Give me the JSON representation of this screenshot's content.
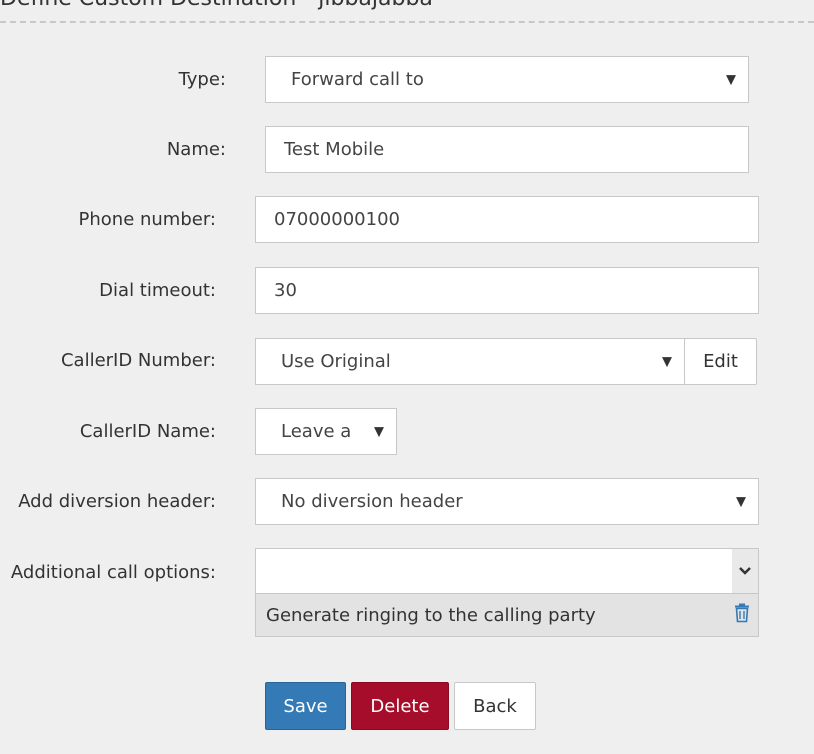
{
  "page": {
    "heading": "Define Custom Destination - jibbajabba"
  },
  "form": {
    "type": {
      "label": "Type:",
      "value": "Forward call to"
    },
    "name": {
      "label": "Name:",
      "value": "Test Mobile"
    },
    "phone": {
      "label": "Phone number:",
      "value": "07000000100"
    },
    "timeout": {
      "label": "Dial timeout:",
      "value": "30"
    },
    "callerid_number": {
      "label": "CallerID Number:",
      "value": "Use Original",
      "edit_label": "Edit"
    },
    "callerid_name": {
      "label": "CallerID Name:",
      "value": "Leave a"
    },
    "diversion": {
      "label": "Add diversion header:",
      "value": "No diversion header"
    },
    "options": {
      "label": "Additional call options:",
      "selected": [
        "Generate ringing to the calling party"
      ]
    }
  },
  "buttons": {
    "save": "Save",
    "delete": "Delete",
    "back": "Back"
  },
  "icons": {
    "select_caret": "caret-down-icon",
    "multiselect_toggle": "chevron-down-icon",
    "remove_option": "trash-icon"
  },
  "colors": {
    "save": "#337ab7",
    "delete": "#a50d2b",
    "trash": "#337ab7"
  }
}
